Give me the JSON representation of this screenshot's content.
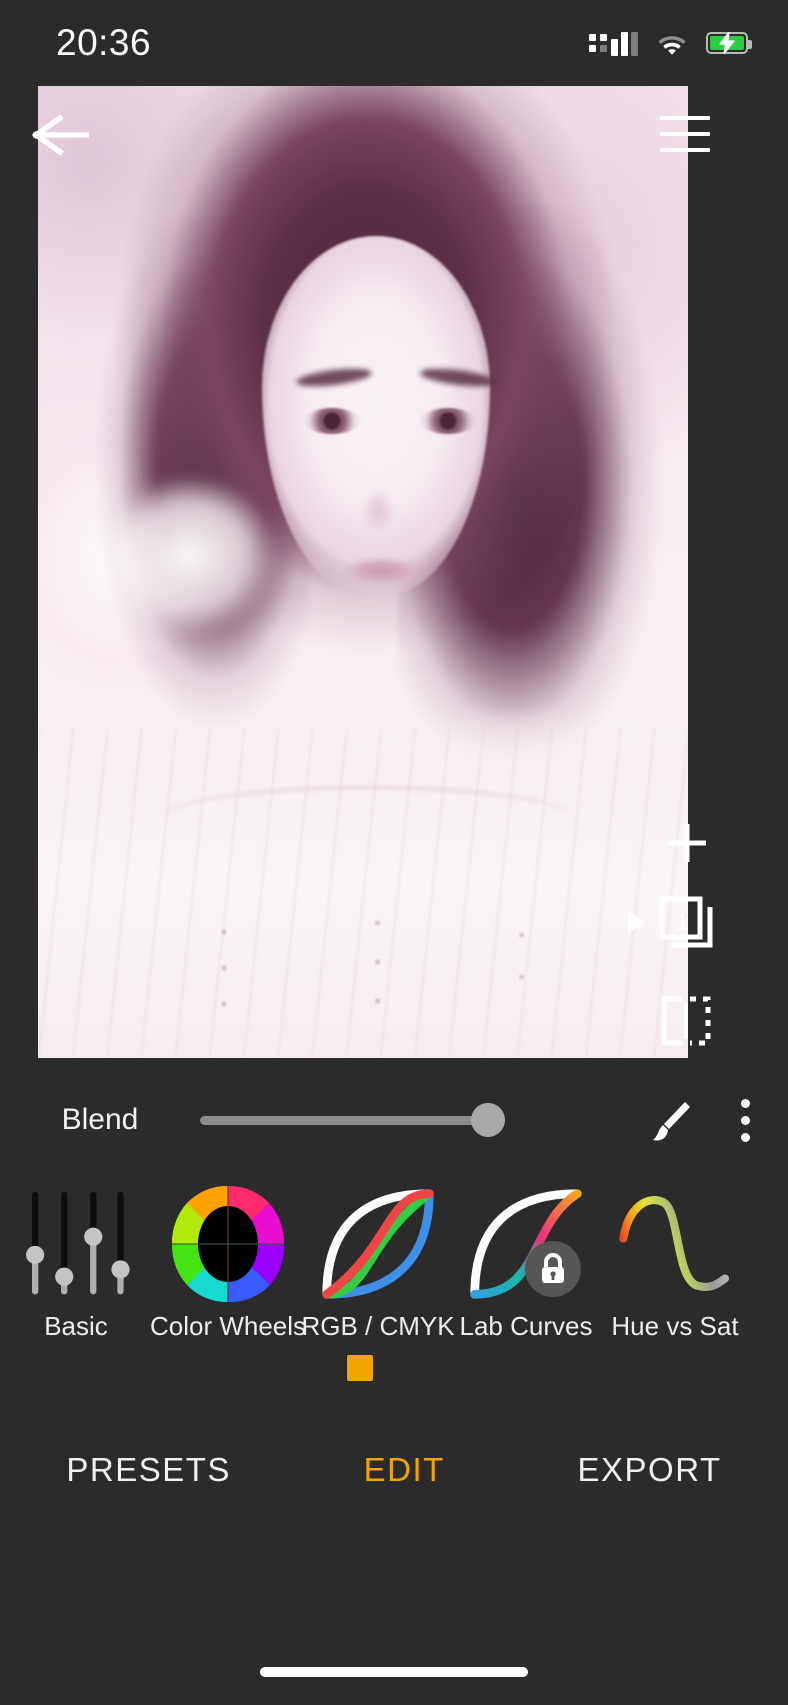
{
  "status_bar": {
    "time": "20:36",
    "signal_icon": "cellular-signal-icon",
    "wifi_icon": "wifi-icon",
    "battery_icon": "battery-charging-icon",
    "battery_color": "#2ecc43"
  },
  "canvas": {
    "back_icon": "back-arrow-icon",
    "menu_icon": "hamburger-menu-icon",
    "add_icon": "plus-icon",
    "play_icon": "play-triangle-icon",
    "layers_icon": "layers-icon",
    "layers_count": "1",
    "compare_icon": "before-after-compare-icon"
  },
  "blend": {
    "label": "Blend",
    "value": 100,
    "brush_icon": "brush-icon",
    "more_icon": "kebab-menu-icon"
  },
  "tools": {
    "items": [
      {
        "label": "Basic",
        "icon": "sliders-icon",
        "locked": false,
        "active": false
      },
      {
        "label": "Color Wheels",
        "icon": "color-wheel-icon",
        "locked": false,
        "active": false
      },
      {
        "label": "RGB / CMYK",
        "icon": "rgb-curves-icon",
        "locked": false,
        "active": true
      },
      {
        "label": "Lab Curves",
        "icon": "lab-curves-icon",
        "locked": true,
        "active": false
      },
      {
        "label": "Hue vs Sat",
        "icon": "hue-sat-curve-icon",
        "locked": false,
        "active": false
      }
    ],
    "active_indicator_color": "#f0a500",
    "lock_icon": "lock-icon"
  },
  "bottom_nav": {
    "items": [
      {
        "label": "PRESETS",
        "active": false
      },
      {
        "label": "EDIT",
        "active": true
      },
      {
        "label": "EXPORT",
        "active": false
      }
    ],
    "active_color": "#f0a500"
  },
  "home_indicator": "home-indicator-bar"
}
